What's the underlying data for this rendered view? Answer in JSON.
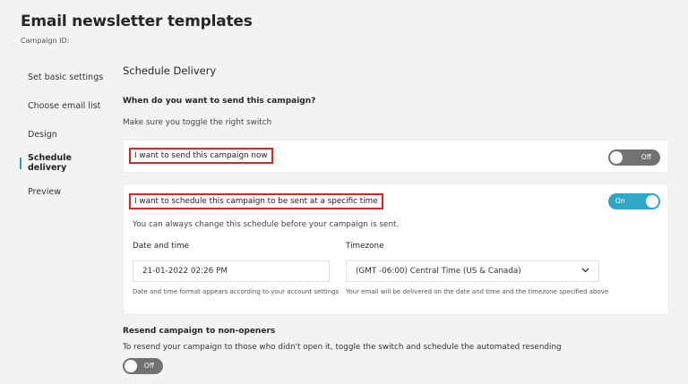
{
  "page": {
    "title": "Email newsletter templates",
    "campaign_id_label": "Campaign ID:"
  },
  "sidebar": {
    "items": [
      {
        "label": "Set basic settings",
        "active": false
      },
      {
        "label": "Choose email list",
        "active": false
      },
      {
        "label": "Design",
        "active": false
      },
      {
        "label": "Schedule delivery",
        "active": true
      },
      {
        "label": "Preview",
        "active": false
      }
    ]
  },
  "schedule": {
    "section_title": "Schedule Delivery",
    "question": "When do you want to send this campaign?",
    "hint": "Make sure you toggle the right switch",
    "send_now": {
      "label": "I want to send this campaign now",
      "toggle": {
        "state": "off",
        "label": "Off"
      }
    },
    "send_later": {
      "label": "I want to schedule this campaign to be sent at a specific time",
      "toggle": {
        "state": "on",
        "label": "On"
      },
      "note": "You can always change this schedule before your campaign is sent.",
      "datetime": {
        "label": "Date and time",
        "value": "21-01-2022 02:26 PM",
        "help": "Date and time format appears according to your account settings"
      },
      "timezone": {
        "label": "Timezone",
        "value": "(GMT -06:00) Central Time (US & Canada)",
        "help": "Your email will be delivered on the date and time and the timezone specified above"
      }
    }
  },
  "resend": {
    "title": "Resend campaign to non-openers",
    "description": "To resend your campaign to those who didn't open it, toggle the switch and schedule the automated resending",
    "toggle": {
      "state": "off",
      "label": "Off"
    }
  },
  "colors": {
    "accent": "#2fa8c7",
    "toggle_off": "#727272",
    "highlight_border": "#d9262c",
    "background": "#f3f3f3"
  },
  "icons": {
    "timezone_dropdown": "chevron-down-icon"
  }
}
